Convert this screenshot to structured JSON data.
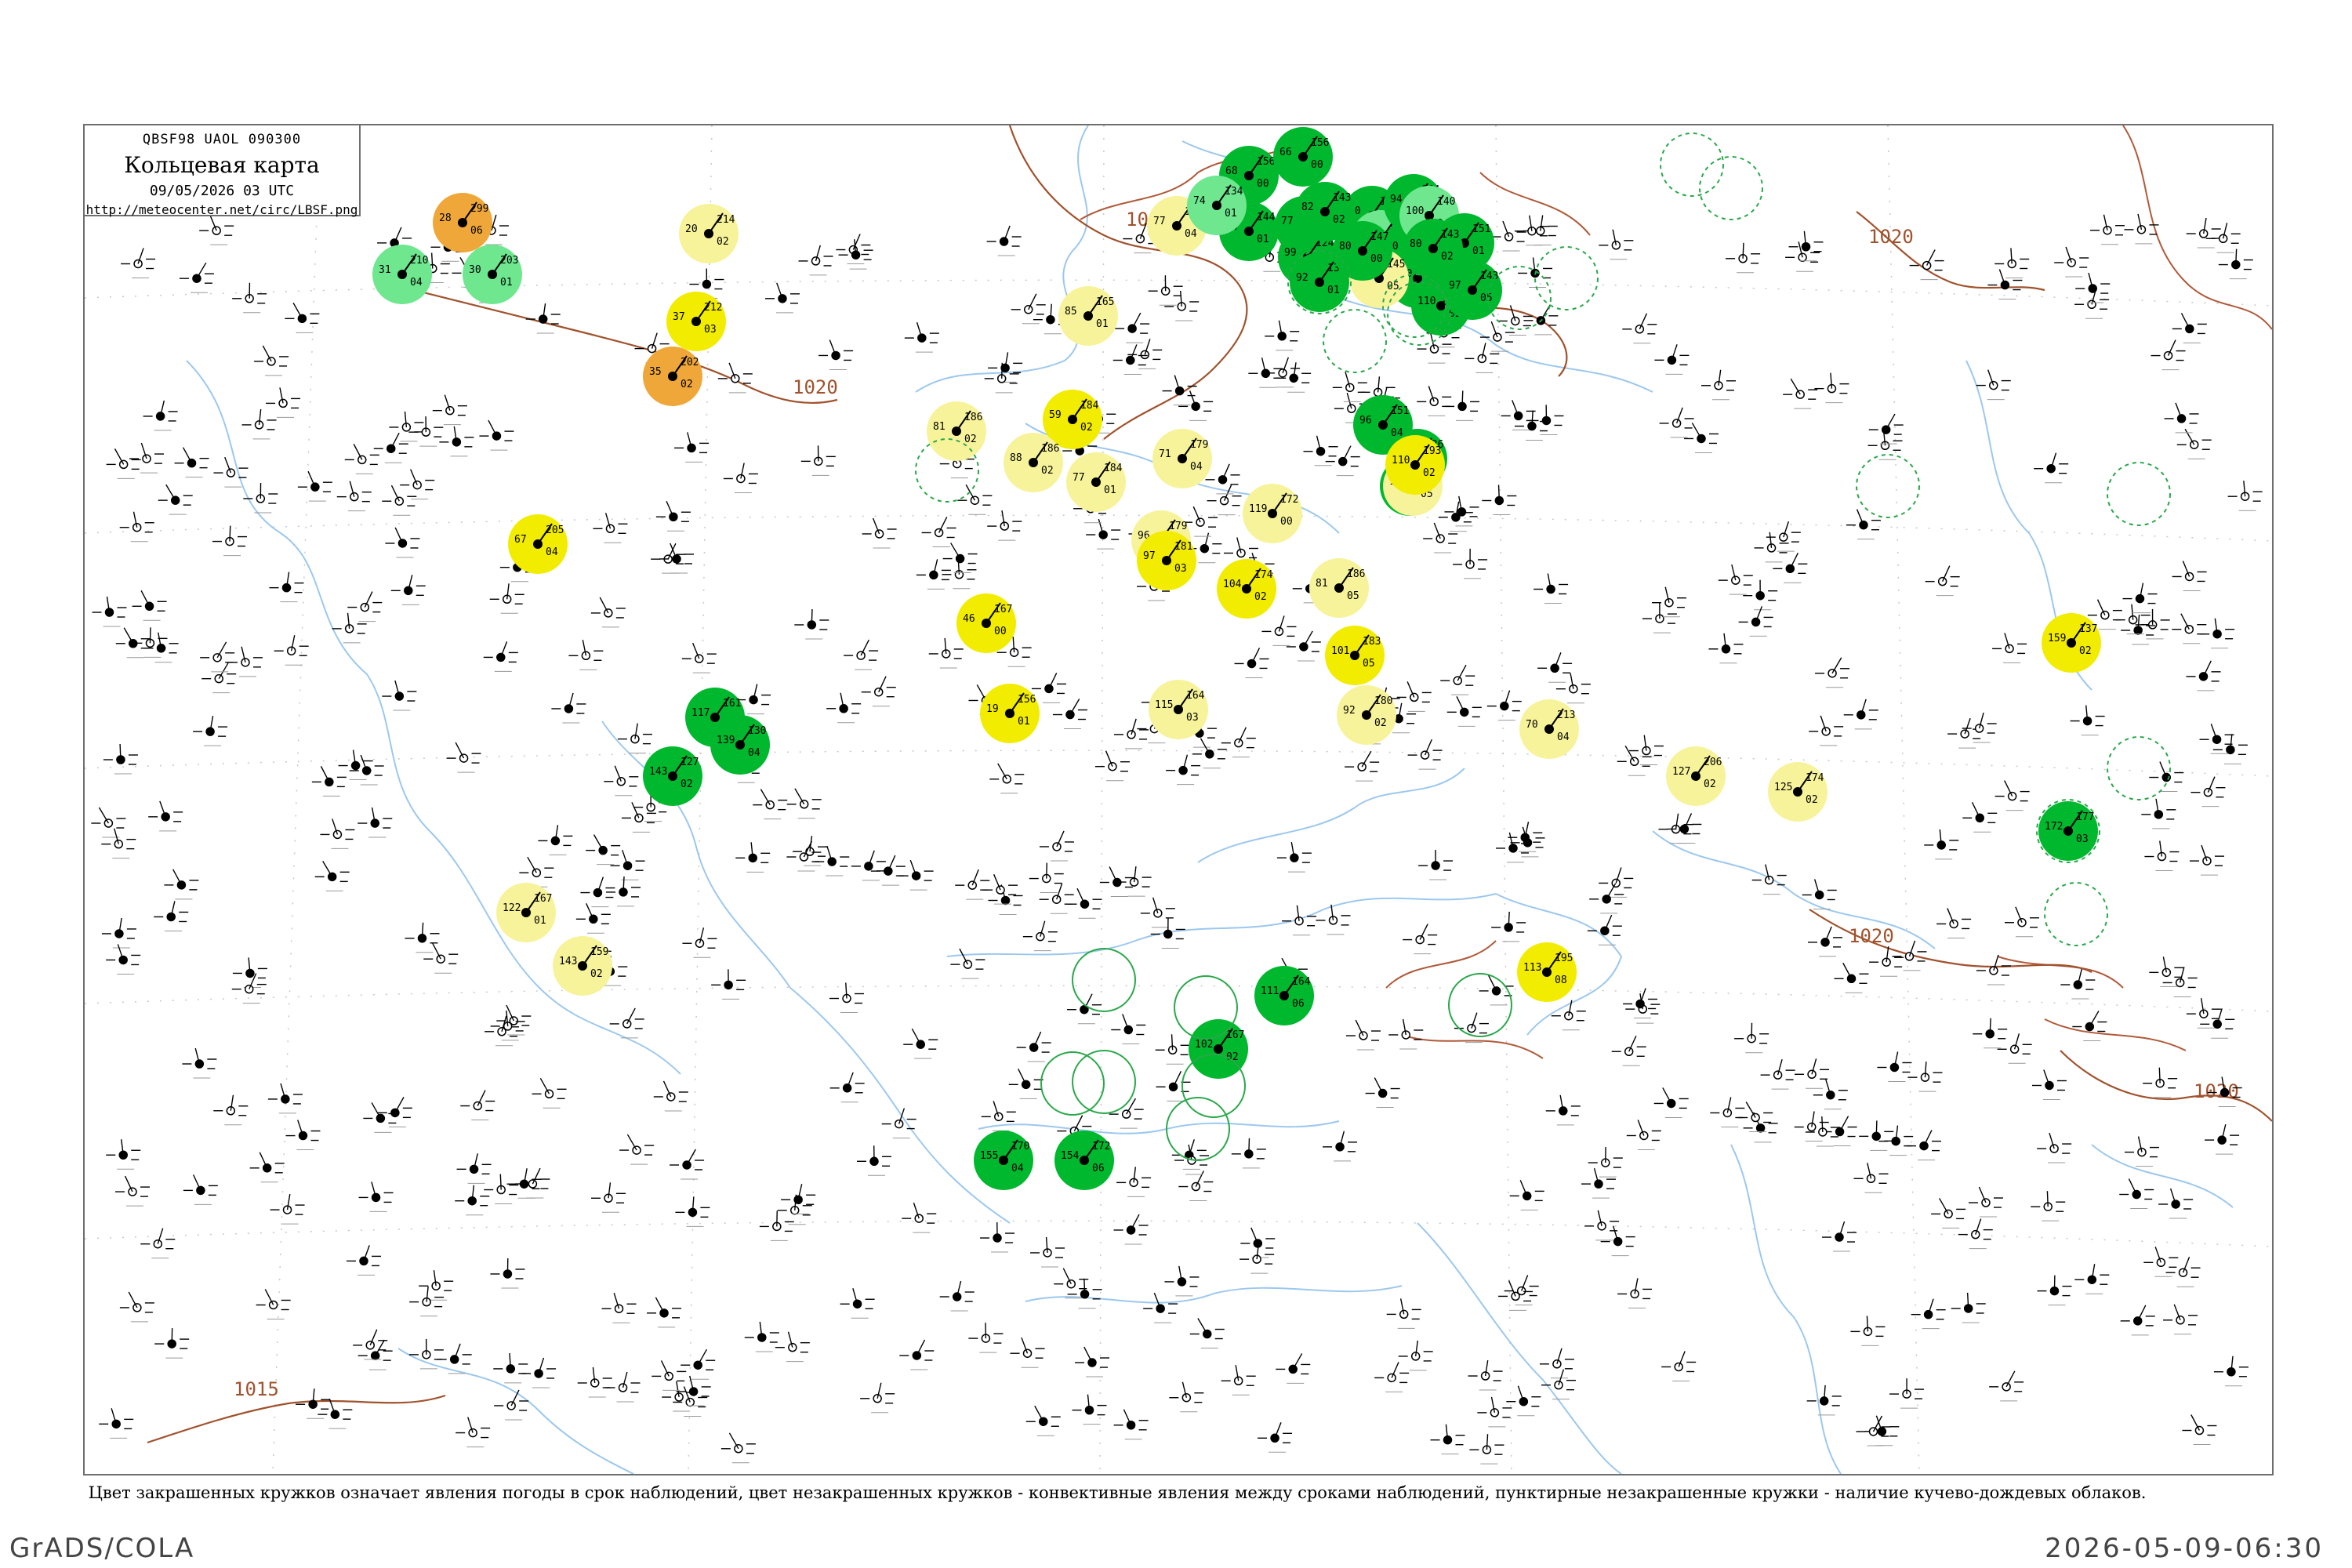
{
  "header": {
    "code": "QBSF98 UAOL 090300",
    "title": "Кольцевая карта",
    "datetime": "09/05/2026 03 UTC",
    "url": "http://meteocenter.net/circ/LBSF.png"
  },
  "caption": "Цвет закрашенных кружков означает явления погоды в срок наблюдений, цвет незакрашенных кружков - конвективные явления между сроками наблюдений, пунктирные незакрашенные кружки - наличие кучево-дождевых облаков.",
  "footer": {
    "left": "GrADS/COLA",
    "right": "2026-05-09-06:30"
  },
  "isobar_labels": [
    {
      "id": "iso-1015-a",
      "text": "1015"
    },
    {
      "id": "iso-1020-a",
      "text": "1020"
    },
    {
      "id": "iso-1020-b",
      "text": "1020"
    },
    {
      "id": "iso-1020-c",
      "text": "1020"
    },
    {
      "id": "iso-1020-d",
      "text": "1020"
    },
    {
      "id": "iso-1015-b",
      "text": "1015"
    }
  ],
  "colors": {
    "green": "#00b82e",
    "light_green": "#6ee78f",
    "yellow": "#f2ec00",
    "light_yellow": "#f7f39a",
    "orange": "#f0a73a",
    "isobar": "#a0522d",
    "water": "#9cc8ee"
  },
  "stations": [
    {
      "id": 1,
      "fill": "orange",
      "p": "299",
      "t": "28",
      "d": "06"
    },
    {
      "id": 2,
      "fill": "light_green",
      "p": "210",
      "t": "31",
      "d": "04"
    },
    {
      "id": 3,
      "fill": "light_green",
      "p": "203",
      "t": "30",
      "d": "01"
    },
    {
      "id": 4,
      "fill": "yellow",
      "p": "212",
      "t": "37",
      "d": "03"
    },
    {
      "id": 5,
      "fill": "orange",
      "p": "202",
      "t": "35",
      "d": "02"
    },
    {
      "id": 6,
      "fill": "light_yellow",
      "p": "214",
      "t": "20",
      "d": "02"
    },
    {
      "id": 7,
      "fill": "yellow",
      "p": "205",
      "t": "67",
      "d": "04"
    },
    {
      "id": 8,
      "fill": "light_yellow",
      "p": "167",
      "t": "122",
      "d": "01"
    },
    {
      "id": 9,
      "fill": "light_yellow",
      "p": "159",
      "t": "143",
      "d": "02"
    },
    {
      "id": 10,
      "fill": "green",
      "p": "156",
      "t": "68",
      "d": "00"
    },
    {
      "id": 11,
      "fill": "green",
      "p": "150",
      "t": "77",
      "d": "02"
    },
    {
      "id": 12,
      "fill": "green",
      "p": "144",
      "t": "74",
      "d": "01"
    },
    {
      "id": 13,
      "fill": "green",
      "p": "124",
      "t": "99",
      "d": "01"
    },
    {
      "id": 14,
      "fill": "green",
      "p": "137",
      "t": "92",
      "d": "01"
    },
    {
      "id": 15,
      "fill": "green",
      "p": "141",
      "t": "90",
      "d": "02"
    },
    {
      "id": 16,
      "fill": "light_green",
      "p": "144",
      "t": "147",
      "d": "00"
    },
    {
      "id": 17,
      "fill": "green",
      "p": "155",
      "t": "80",
      "d": "01"
    },
    {
      "id": 18,
      "fill": "green",
      "p": "131",
      "t": "100",
      "d": "04"
    },
    {
      "id": 19,
      "fill": "green",
      "p": "130",
      "t": "110",
      "d": "02"
    },
    {
      "id": 20,
      "fill": "light_yellow",
      "p": "145",
      "t": "120",
      "d": "05"
    },
    {
      "id": 21,
      "fill": "yellow",
      "p": "156",
      "t": "19",
      "d": "01"
    },
    {
      "id": 22,
      "fill": "yellow",
      "p": "167",
      "t": "46",
      "d": "00"
    },
    {
      "id": 23,
      "fill": "yellow",
      "p": "184",
      "t": "59",
      "d": "02"
    },
    {
      "id": 24,
      "fill": "light_yellow",
      "p": "186",
      "t": "81",
      "d": "02"
    },
    {
      "id": 25,
      "fill": "light_yellow",
      "p": "186",
      "t": "88",
      "d": "02"
    },
    {
      "id": 26,
      "fill": "light_yellow",
      "p": "184",
      "t": "77",
      "d": "01"
    },
    {
      "id": 27,
      "fill": "light_yellow",
      "p": "165",
      "t": "85",
      "d": "01"
    },
    {
      "id": 28,
      "fill": "light_yellow",
      "p": "179",
      "t": "96",
      "d": "01"
    },
    {
      "id": 29,
      "fill": "yellow",
      "p": "181",
      "t": "97",
      "d": "03"
    },
    {
      "id": 30,
      "fill": "light_yellow",
      "p": "179",
      "t": "71",
      "d": "04"
    },
    {
      "id": 31,
      "fill": "yellow",
      "p": "174",
      "t": "104",
      "d": "02"
    },
    {
      "id": 32,
      "fill": "light_yellow",
      "p": "172",
      "t": "119",
      "d": "00"
    },
    {
      "id": 33,
      "fill": "light_yellow",
      "p": "186",
      "t": "81",
      "d": "05"
    },
    {
      "id": 34,
      "fill": "yellow",
      "p": "183",
      "t": "101",
      "d": "05"
    },
    {
      "id": 35,
      "fill": "light_yellow",
      "p": "180",
      "t": "92",
      "d": "02"
    },
    {
      "id": 36,
      "fill": "light_yellow",
      "p": "164",
      "t": "115",
      "d": "03"
    },
    {
      "id": 37,
      "fill": "light_yellow",
      "p": "132",
      "t": "77",
      "d": "04"
    },
    {
      "id": 38,
      "fill": "light_green",
      "p": "134",
      "t": "74",
      "d": "01"
    },
    {
      "id": 39,
      "fill": "green",
      "p": "156",
      "t": "66",
      "d": "00"
    },
    {
      "id": 40,
      "fill": "green",
      "p": "143",
      "t": "82",
      "d": "02"
    },
    {
      "id": 41,
      "fill": "green",
      "p": "147",
      "t": "80",
      "d": "00"
    },
    {
      "id": 42,
      "fill": "green",
      "p": "144",
      "t": "94",
      "d": "02"
    },
    {
      "id": 43,
      "fill": "light_green",
      "p": "140",
      "t": "100",
      "d": "04"
    },
    {
      "id": 44,
      "fill": "green",
      "p": "151",
      "t": "92",
      "d": "01"
    },
    {
      "id": 45,
      "fill": "green",
      "p": "143",
      "t": "97",
      "d": "05"
    },
    {
      "id": 46,
      "fill": "green",
      "p": "143",
      "t": "80",
      "d": "02"
    },
    {
      "id": 47,
      "fill": "green",
      "p": "133",
      "t": "93",
      "d": "04"
    },
    {
      "id": 48,
      "fill": "green",
      "p": "136",
      "t": "95",
      "d": "03"
    },
    {
      "id": 49,
      "fill": "light_yellow",
      "p": "149",
      "t": "145",
      "d": "05"
    },
    {
      "id": 50,
      "fill": "green",
      "p": "151",
      "t": "96",
      "d": "04"
    },
    {
      "id": 51,
      "fill": "yellow",
      "p": "193",
      "t": "110",
      "d": "02"
    },
    {
      "id": 52,
      "fill": "light_yellow",
      "p": "213",
      "t": "70",
      "d": "04"
    },
    {
      "id": 53,
      "fill": "light_yellow",
      "p": "206",
      "t": "127",
      "d": "02"
    },
    {
      "id": 54,
      "fill": "light_yellow",
      "p": "174",
      "t": "125",
      "d": "02"
    },
    {
      "id": 55,
      "fill": "yellow",
      "p": "137",
      "t": "159",
      "d": "02"
    },
    {
      "id": 56,
      "fill": "green",
      "p": "177",
      "t": "172",
      "d": "03"
    },
    {
      "id": 57,
      "fill": "yellow",
      "p": "195",
      "t": "113",
      "d": "08"
    },
    {
      "id": 58,
      "fill": "green",
      "p": "164",
      "t": "111",
      "d": "06"
    },
    {
      "id": 59,
      "fill": "green",
      "p": "167",
      "t": "102",
      "d": "02"
    },
    {
      "id": 60,
      "fill": "green",
      "p": "170",
      "t": "155",
      "d": "04"
    },
    {
      "id": 61,
      "fill": "green",
      "p": "172",
      "t": "154",
      "d": "06"
    },
    {
      "id": 62,
      "fill": "green",
      "p": "161",
      "t": "117",
      "d": "01"
    },
    {
      "id": 63,
      "fill": "green",
      "p": "127",
      "t": "143",
      "d": "02"
    },
    {
      "id": 64,
      "fill": "green",
      "p": "130",
      "t": "139",
      "d": "04"
    }
  ],
  "dashed_rings": [
    {
      "id": 1
    },
    {
      "id": 2
    },
    {
      "id": 3
    },
    {
      "id": 4
    },
    {
      "id": 5
    },
    {
      "id": 6
    },
    {
      "id": 7
    },
    {
      "id": 8
    },
    {
      "id": 9
    },
    {
      "id": 10
    },
    {
      "id": 11
    },
    {
      "id": 12
    },
    {
      "id": 13
    },
    {
      "id": 14
    }
  ],
  "solid_rings": [
    {
      "id": 1
    },
    {
      "id": 2
    },
    {
      "id": 3
    },
    {
      "id": 4
    },
    {
      "id": 5
    },
    {
      "id": 6
    },
    {
      "id": 7
    }
  ]
}
